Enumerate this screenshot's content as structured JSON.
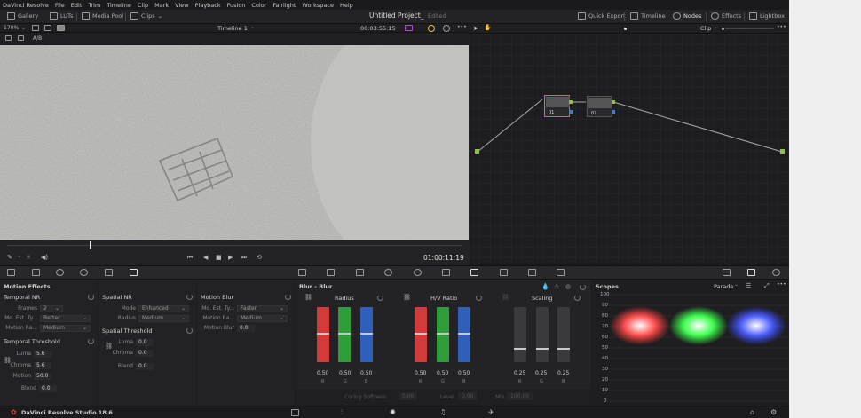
{
  "menu": [
    "DaVinci Resolve",
    "File",
    "Edit",
    "Trim",
    "Timeline",
    "Clip",
    "Mark",
    "View",
    "Playback",
    "Fusion",
    "Color",
    "Fairlight",
    "Workspace",
    "Help"
  ],
  "toolbar": {
    "gallery": "Gallery",
    "luts": "LUTs",
    "media_pool": "Media Pool",
    "clips": "Clips",
    "project_title": "Untitled Project_",
    "edited": "Edited",
    "quick_export": "Quick Export",
    "timeline": "Timeline",
    "nodes": "Nodes",
    "effects": "Effects",
    "lightbox": "Lightbox"
  },
  "viewer": {
    "zoom": "170%",
    "timeline_name": "Timeline 1",
    "timecode_top": "00:03:55:15",
    "ab": "A/B",
    "timecode": "01:00:11:19"
  },
  "nodes": {
    "mode": "Clip",
    "node1": "01",
    "node2": "02"
  },
  "motion_effects": {
    "title": "Motion Effects",
    "temporal_nr": "Temporal NR",
    "frames_label": "Frames",
    "frames_value": "2",
    "mo_est_label": "Mo. Est. Ty...",
    "mo_est_value": "Better",
    "motion_range_label": "Motion Ra...",
    "motion_range_value": "Medium",
    "temporal_threshold": "Temporal Threshold",
    "luma_label": "Luma",
    "luma_value": "5.6",
    "chroma_label": "Chroma",
    "chroma_value": "5.6",
    "motion_label": "Motion",
    "motion_value": "50.0",
    "blend_label": "Blend",
    "blend_value": "0.0"
  },
  "spatial_nr": {
    "title": "Spatial NR",
    "mode_label": "Mode",
    "mode_value": "Enhanced",
    "radius_label": "Radius",
    "radius_value": "Medium",
    "threshold_title": "Spatial Threshold",
    "luma_label": "Luma",
    "luma_value": "0.0",
    "chroma_label": "Chroma",
    "chroma_value": "0.0",
    "blend_label": "Blend",
    "blend_value": "0.0"
  },
  "motion_blur": {
    "title": "Motion Blur",
    "mo_est_label": "Mo. Est. Ty...",
    "mo_est_value": "Faster",
    "motion_range_label": "Motion Ra...",
    "motion_range_value": "Medium",
    "blur_label": "Motion Blur",
    "blur_value": "0.0"
  },
  "blur": {
    "title": "Blur - Blur",
    "radius": "Radius",
    "hv_ratio": "H/V Ratio",
    "scaling": "Scaling",
    "radius_vals": [
      "0.50",
      "0.50",
      "0.50"
    ],
    "hv_vals": [
      "0.50",
      "0.50",
      "0.50"
    ],
    "scaling_vals": [
      "0.25",
      "0.25",
      "0.25"
    ],
    "ch": [
      "R",
      "G",
      "B"
    ],
    "coring_label": "Coring Softness",
    "coring_value": "0.00",
    "level_label": "Level",
    "level_value": "0.00",
    "mix_label": "Mix",
    "mix_value": "100.00"
  },
  "scopes": {
    "title": "Scopes",
    "mode": "Parade",
    "ticks": [
      "100",
      "90",
      "80",
      "70",
      "60",
      "50",
      "40",
      "30",
      "20",
      "10",
      "0"
    ]
  },
  "footer": {
    "app": "DaVinci Resolve Studio 18.6"
  },
  "colors": {
    "red": "#d43a3a",
    "green": "#2f9d3a",
    "blue": "#2f5fb8",
    "accent": "#e8a23a"
  }
}
